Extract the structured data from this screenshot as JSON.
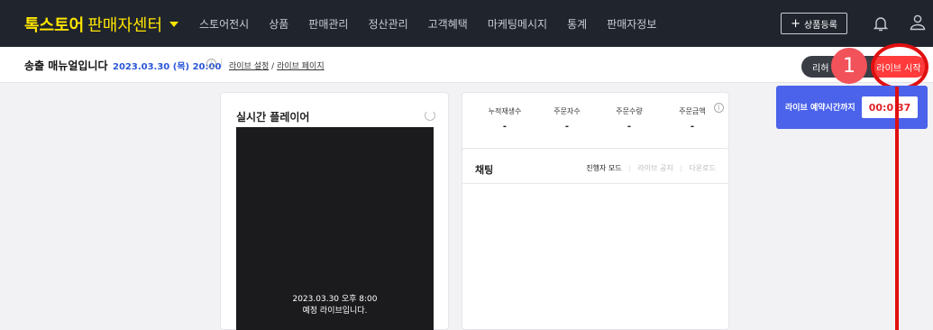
{
  "nav": {
    "brand_main": "톡스토어",
    "brand_sub": "판매자센터",
    "menu": [
      "스토어전시",
      "상품",
      "판매관리",
      "정산관리",
      "고객혜택",
      "마케팅메시지",
      "통계",
      "판매자정보"
    ],
    "add_product": "상품등록"
  },
  "subbar": {
    "title": "송출 매뉴얼입니다",
    "datetime": "2023.03.30 (목) 20:00",
    "link_settings": "라이브 설정",
    "link_slash": "/",
    "link_page": "라이브 페이지",
    "btn_dark": "리허",
    "btn_live_start": "라이브 시작"
  },
  "annotation": {
    "step_number": "1"
  },
  "countdown": {
    "label": "라이브 예약시간까지",
    "time": "00:0 37"
  },
  "player": {
    "title": "실시간 플레이어",
    "line1": "2023.03.30 오후 8:00",
    "line2": "예정 라이브입니다."
  },
  "stats": [
    {
      "label": "누적재생수",
      "value": "-"
    },
    {
      "label": "주문자수",
      "value": "-"
    },
    {
      "label": "주문수량",
      "value": "-"
    },
    {
      "label": "주문금액",
      "value": "-"
    }
  ],
  "chat": {
    "title": "채팅",
    "tab_host": "진행자 모드",
    "tab_notice": "라이브 공지",
    "tab_download": "다운로드"
  },
  "colors": {
    "nav_bg": "#20242d",
    "brand_yellow": "#fee500",
    "live_red": "#ff3b3b",
    "countdown_blue": "#4b63ea",
    "annotation_red": "#e01010"
  }
}
